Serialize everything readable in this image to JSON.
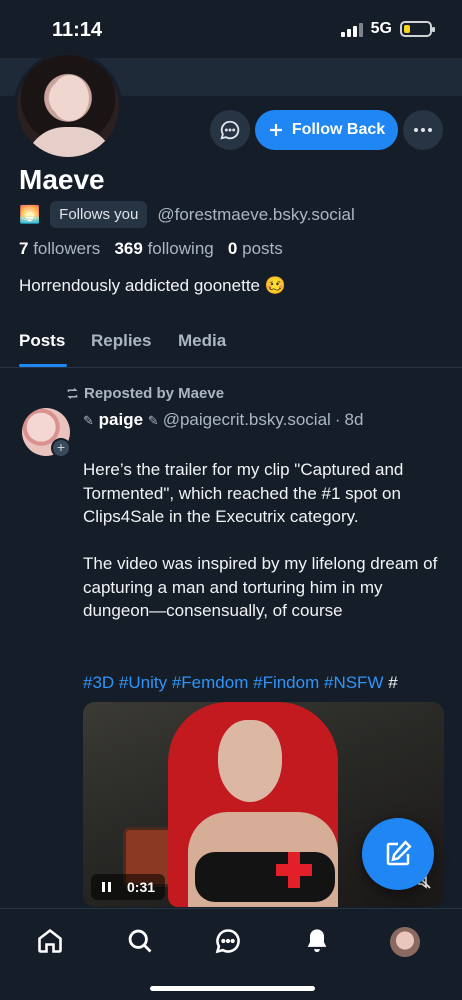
{
  "status_bar": {
    "time": "11:14",
    "network": "5G",
    "battery_level": 0.25
  },
  "profile": {
    "display_name": "Maeve",
    "emoji": "🌅",
    "follows_you": "Follows you",
    "handle": "@forestmaeve.bsky.social",
    "followers_count": "7",
    "followers_label": "followers",
    "following_count": "369",
    "following_label": "following",
    "posts_count": "0",
    "posts_label": "posts",
    "bio": "Horrendously addicted goonette 🥴",
    "follow_button": "Follow Back"
  },
  "tabs": [
    "Posts",
    "Replies",
    "Media"
  ],
  "post": {
    "repost_label": "Reposted by Maeve",
    "author_name": "paige",
    "author_handle": "@paigecrit.bsky.social",
    "separator": "·",
    "time": "8d",
    "paragraph_1": "Here’s the trailer for my clip \"Captured and Tormented\", which reached the #1 spot on Clips4Sale in the Executrix category.",
    "paragraph_2": "The video was inspired by my lifelong dream of capturing a man and torturing him in my dungeon—consensually, of course",
    "hashtags": [
      "#3D",
      "#Unity",
      "#Femdom",
      "#Findom",
      "#NSFW"
    ],
    "trailing_hash": "#",
    "video_time": "0:31"
  },
  "colors": {
    "accent": "#1f86f4",
    "background": "#151d28",
    "muted": "#aab6c3"
  },
  "icons": [
    "message-icon",
    "plus-icon",
    "more-icon",
    "repost-icon",
    "pause-icon",
    "mute-icon",
    "compose-icon",
    "home-icon",
    "search-icon",
    "chat-icon",
    "bell-icon"
  ]
}
